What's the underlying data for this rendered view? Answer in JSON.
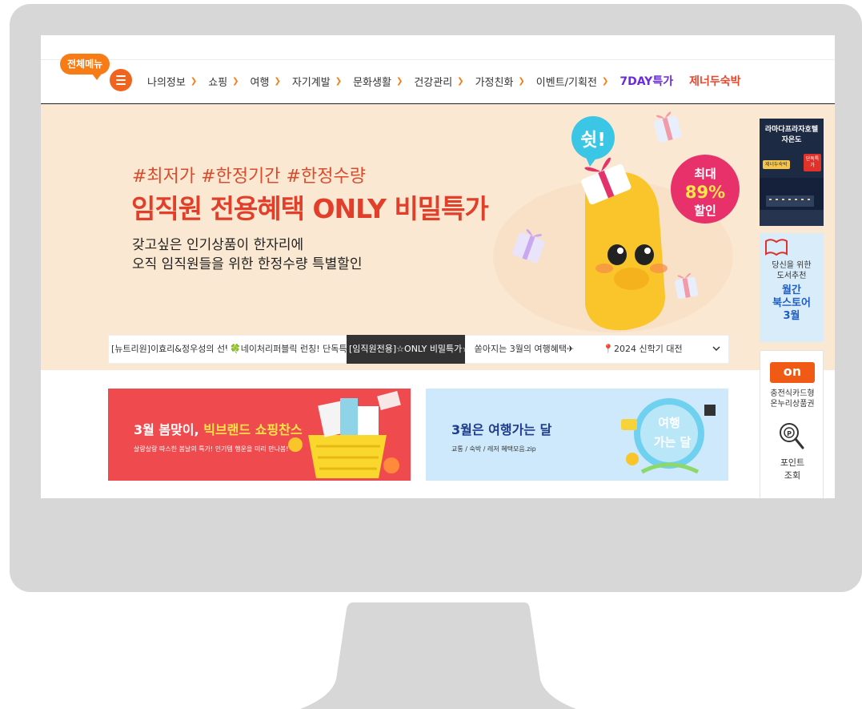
{
  "header": {
    "all_menu_label": "전체메뉴",
    "nav": [
      {
        "label": "나의정보"
      },
      {
        "label": "쇼핑"
      },
      {
        "label": "여행"
      },
      {
        "label": "자기계발"
      },
      {
        "label": "문화생활"
      },
      {
        "label": "건강관리"
      },
      {
        "label": "가정친화"
      },
      {
        "label": "이벤트/기획전"
      }
    ],
    "special_nav": [
      {
        "label": "7DAY특가",
        "color": "#6b2bd9"
      },
      {
        "label": "제너두숙박",
        "color": "#e8472b"
      }
    ]
  },
  "hero": {
    "hashtags": "#최저가 #한정기간 #한정수량",
    "title": "임직원 전용혜택 ONLY 비밀특가",
    "desc_line1": "갖고싶은 인기상품이 한자리에",
    "desc_line2": "오직 임직원들을 위한 한정수량 특별할인",
    "bubble_text": "쉿!",
    "badge_line1": "최대",
    "badge_line2": "89%",
    "badge_line3": "할인"
  },
  "tabs": {
    "items": [
      {
        "label": "[뉴트리원]이효리&정우성의 선택!",
        "active": false
      },
      {
        "label": "🍀네이처리퍼블릭 런칭! 단독특가",
        "active": false
      },
      {
        "label": "[임직원전용]☆ONLY 비밀특가☆",
        "active": true
      },
      {
        "label": "쏟아지는 3월의 여행혜택✈",
        "active": false
      },
      {
        "label": "📍2024 신학기 대전",
        "active": false
      }
    ],
    "more_icon": "chevron-down-icon"
  },
  "banners": {
    "shopping": {
      "title_prefix": "3월 봄맞이, ",
      "title_highlight": "빅브랜드 쇼핑찬스",
      "subtitle": "살랑살랑 따스한 봄날의 특가! 인기템 행운을 미리 만나봄!"
    },
    "travel": {
      "title": "3월은 여행가는 달",
      "subtitle": "교통 / 숙박 / 레저 혜택모음.zip",
      "art_line1": "여행",
      "art_line2": "가는 달"
    }
  },
  "sidebar": {
    "hotel": {
      "line1": "라마다프라자호텔",
      "line2": "자은도",
      "chip": "제너두숙박",
      "chip2": "단독특가"
    },
    "book": {
      "line1": "당신을 위한",
      "line2": "도서추천",
      "line3": "월간",
      "line4": "북스토어",
      "line5": "3월"
    },
    "charge": {
      "logo": "on",
      "line1": "충전식카드형",
      "line2": "온누리상품권"
    },
    "point": {
      "line1": "포인트",
      "line2": "조회"
    }
  },
  "colors": {
    "accent": "#f77c16",
    "hero_bg": "#fbe8d2",
    "title_red": "#e23f2b",
    "monitor": "#d7d7d7"
  }
}
